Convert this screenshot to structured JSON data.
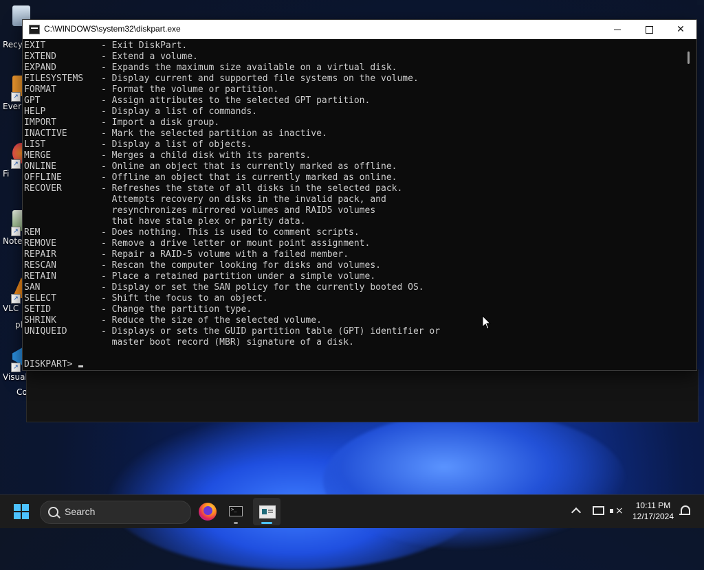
{
  "desktop": {
    "icons": [
      {
        "label": "Recy",
        "icon": "recycle-bin-icon"
      },
      {
        "label": "Ever",
        "icon": "app-shortcut-icon"
      },
      {
        "label": "Fi",
        "icon": "firefox-shortcut-icon"
      },
      {
        "label": "Note",
        "icon": "notepad-shortcut-icon"
      },
      {
        "label": "VLC",
        "sublabel": "pl",
        "icon": "vlc-shortcut-icon"
      },
      {
        "label": "Visual",
        "sublabel": "Co",
        "icon": "vscode-shortcut-icon"
      }
    ]
  },
  "window": {
    "title": "C:\\WINDOWS\\system32\\diskpart.exe",
    "buttons": {
      "minimize": "minimize",
      "maximize": "maximize",
      "close": "✕"
    }
  },
  "terminal": {
    "lines": [
      {
        "cmd": "EXIT",
        "desc": "- Exit DiskPart."
      },
      {
        "cmd": "EXTEND",
        "desc": "- Extend a volume."
      },
      {
        "cmd": "EXPAND",
        "desc": "- Expands the maximum size available on a virtual disk."
      },
      {
        "cmd": "FILESYSTEMS",
        "desc": "- Display current and supported file systems on the volume."
      },
      {
        "cmd": "FORMAT",
        "desc": "- Format the volume or partition."
      },
      {
        "cmd": "GPT",
        "desc": "- Assign attributes to the selected GPT partition."
      },
      {
        "cmd": "HELP",
        "desc": "- Display a list of commands."
      },
      {
        "cmd": "IMPORT",
        "desc": "- Import a disk group."
      },
      {
        "cmd": "INACTIVE",
        "desc": "- Mark the selected partition as inactive."
      },
      {
        "cmd": "LIST",
        "desc": "- Display a list of objects."
      },
      {
        "cmd": "MERGE",
        "desc": "- Merges a child disk with its parents."
      },
      {
        "cmd": "ONLINE",
        "desc": "- Online an object that is currently marked as offline."
      },
      {
        "cmd": "OFFLINE",
        "desc": "- Offline an object that is currently marked as online."
      },
      {
        "cmd": "RECOVER",
        "desc": "- Refreshes the state of all disks in the selected pack."
      },
      {
        "cmd": "",
        "desc": "  Attempts recovery on disks in the invalid pack, and"
      },
      {
        "cmd": "",
        "desc": "  resynchronizes mirrored volumes and RAID5 volumes"
      },
      {
        "cmd": "",
        "desc": "  that have stale plex or parity data."
      },
      {
        "cmd": "REM",
        "desc": "- Does nothing. This is used to comment scripts."
      },
      {
        "cmd": "REMOVE",
        "desc": "- Remove a drive letter or mount point assignment."
      },
      {
        "cmd": "REPAIR",
        "desc": "- Repair a RAID-5 volume with a failed member."
      },
      {
        "cmd": "RESCAN",
        "desc": "- Rescan the computer looking for disks and volumes."
      },
      {
        "cmd": "RETAIN",
        "desc": "- Place a retained partition under a simple volume."
      },
      {
        "cmd": "SAN",
        "desc": "- Display or set the SAN policy for the currently booted OS."
      },
      {
        "cmd": "SELECT",
        "desc": "- Shift the focus to an object."
      },
      {
        "cmd": "SETID",
        "desc": "- Change the partition type."
      },
      {
        "cmd": "SHRINK",
        "desc": "- Reduce the size of the selected volume."
      },
      {
        "cmd": "UNIQUEID",
        "desc": "- Displays or sets the GUID partition table (GPT) identifier or"
      },
      {
        "cmd": "",
        "desc": "  master boot record (MBR) signature of a disk."
      },
      {
        "cmd": "",
        "desc": ""
      }
    ],
    "prompt": "DISKPART>"
  },
  "taskbar": {
    "search_placeholder": "Search",
    "apps": [
      {
        "name": "Firefox",
        "icon": "firefox-icon"
      },
      {
        "name": "Terminal",
        "icon": "terminal-icon"
      },
      {
        "name": "Diskpart",
        "icon": "diskpart-icon",
        "active": true
      }
    ],
    "time": "10:11 PM",
    "date": "12/17/2024",
    "accent": "#4cc2ff"
  }
}
